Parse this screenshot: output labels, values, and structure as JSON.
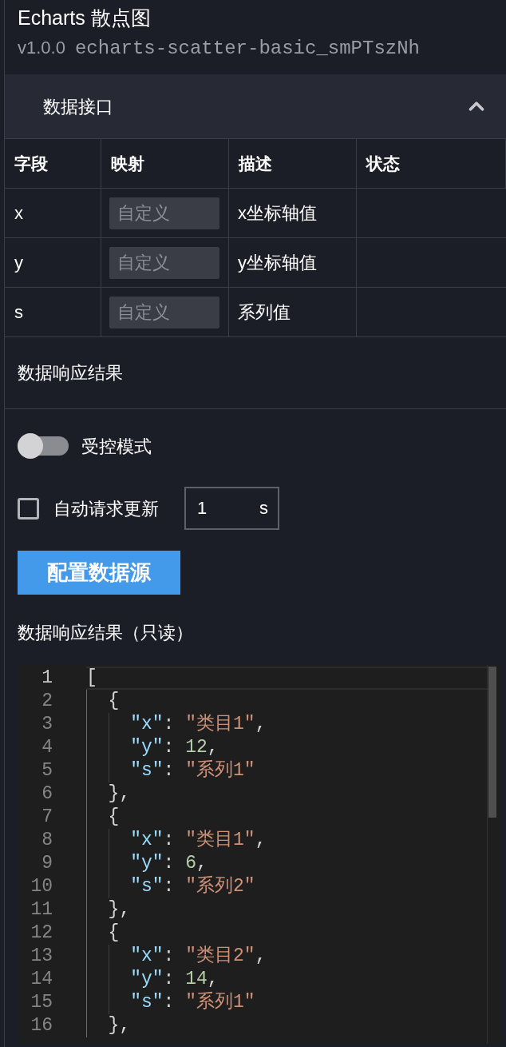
{
  "header": {
    "title": "Echarts 散点图",
    "version": "v1.0.0",
    "component_id": "echarts-scatter-basic_smPTszNh"
  },
  "data_interface": {
    "title": "数据接口",
    "expanded": true,
    "table": {
      "columns": [
        "字段",
        "映射",
        "描述",
        "状态"
      ],
      "rows": [
        {
          "field": "x",
          "mapping": {
            "placeholder": "自定义"
          },
          "description": "x坐标轴值"
        },
        {
          "field": "y",
          "mapping": {
            "placeholder": "自定义"
          },
          "description": "y坐标轴值"
        },
        {
          "field": "s",
          "mapping": {
            "placeholder": "自定义"
          },
          "description": "系列值"
        }
      ]
    }
  },
  "response_section": {
    "title": "数据响应结果"
  },
  "controlled_mode": {
    "label": "受控模式",
    "on": false
  },
  "auto_update": {
    "label": "自动请求更新",
    "checked": false,
    "interval": "1",
    "unit": "s"
  },
  "configure_button": {
    "label": "配置数据源"
  },
  "result_viewer": {
    "title": "数据响应结果（只读）",
    "lines": [
      {
        "number": "1",
        "text": "[",
        "current": true
      },
      {
        "number": "2",
        "text": "  {",
        "current": false
      },
      {
        "number": "3",
        "text": "    \"x\": \"类目1\",",
        "current": false
      },
      {
        "number": "4",
        "text": "    \"y\": 12,",
        "current": false
      },
      {
        "number": "5",
        "text": "    \"s\": \"系列1\"",
        "current": false
      },
      {
        "number": "6",
        "text": "  },",
        "current": false
      },
      {
        "number": "7",
        "text": "  {",
        "current": false
      },
      {
        "number": "8",
        "text": "    \"x\": \"类目1\",",
        "current": false
      },
      {
        "number": "9",
        "text": "    \"y\": 6,",
        "current": false
      },
      {
        "number": "10",
        "text": "    \"s\": \"系列2\"",
        "current": false
      },
      {
        "number": "11",
        "text": "  },",
        "current": false
      },
      {
        "number": "12",
        "text": "  {",
        "current": false
      },
      {
        "number": "13",
        "text": "    \"x\": \"类目2\",",
        "current": false
      },
      {
        "number": "14",
        "text": "    \"y\": 14,",
        "current": false
      },
      {
        "number": "15",
        "text": "    \"s\": \"系列1\"",
        "current": false
      },
      {
        "number": "16",
        "text": "  },",
        "current": false
      }
    ]
  }
}
